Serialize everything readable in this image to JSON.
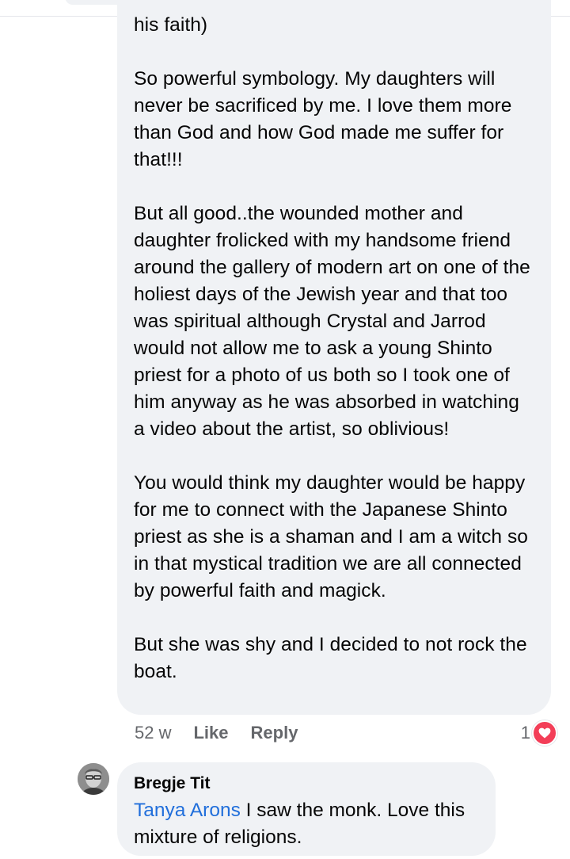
{
  "comment": {
    "text": "his faith)\n\nSo powerful symbology.  My daughters will never be sacrificed by me.  I love them more than God and how God made me suffer for that!!!\n\nBut all good..the wounded mother and daughter frolicked with my handsome friend around the gallery of modern art  on one of the holiest days of the Jewish year and that too was spiritual although Crystal and Jarrod would not allow me to ask a young Shinto priest for a photo of us both so I took one of him anyway as he was absorbed in watching a video about the artist, so oblivious!\n\nYou would think my daughter would be happy for me to connect with the Japanese Shinto priest as she is a shaman and I am a witch so in that mystical tradition we are all connected by powerful faith and magick.\n\nBut she was shy and I decided to not rock the boat.",
    "time": "52 w",
    "like_label": "Like",
    "reply_label": "Reply",
    "reaction_count": "1",
    "reaction_icon": "heart-reaction-icon",
    "reaction_color": "#f33e58"
  },
  "reply": {
    "author": "Bregje Tit",
    "mention": "Tanya Arons",
    "text": " I saw the monk. Love this mixture of religions.",
    "avatar_icon": "user-avatar"
  },
  "colors": {
    "bubble": "#f0f2f5",
    "mention": "#216fdb",
    "meta": "#65676b"
  }
}
